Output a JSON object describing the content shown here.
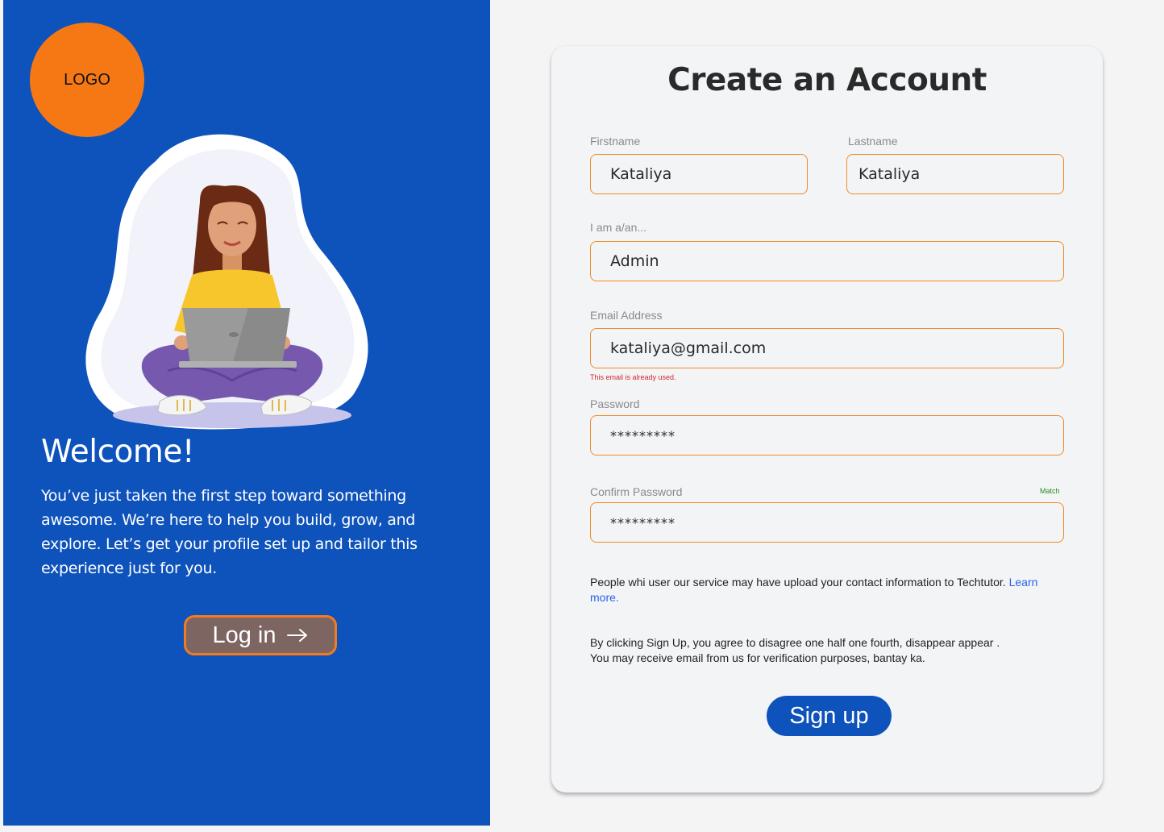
{
  "brand": {
    "logo_text": "LOGO",
    "logo_color": "#f67814",
    "primary_color": "#0e52bb",
    "accent_color": "#f37a21"
  },
  "welcome": {
    "title": "Welcome!",
    "text": "You’ve just taken the first step toward something awesome. We’re here to help you build, grow, and explore. Let’s get your profile set up and tailor this experience just for you.",
    "login_label": "Log in",
    "login_icon": "arrow-right-icon"
  },
  "form": {
    "title": "Create an Account",
    "firstname": {
      "label": "Firstname",
      "value": "Kataliya"
    },
    "lastname": {
      "label": "Lastname",
      "value": "Kataliya"
    },
    "role": {
      "label": "I am a/an...",
      "value": "Admin"
    },
    "email": {
      "label": "Email Address",
      "value": "kataliya@gmail.com",
      "error": "This email is already used."
    },
    "password": {
      "label": "Password",
      "value": "*********"
    },
    "confirm_password": {
      "label": "Confirm Password",
      "value": "*********",
      "status": "Match"
    },
    "contact_info_text": "People whi user our  service may have upload your contact information to Techtutor.",
    "learn_more": "Learn more.",
    "terms_line1": "By clicking Sign Up, you agree to disagree one half one fourth, disappear appear .",
    "terms_line2": "You may receive email from us for verification purposes, bantay ka.",
    "signup_label": "Sign up"
  },
  "colors": {
    "error": "#d7262b",
    "success": "#2a8b24",
    "link": "#2563eb",
    "input_border": "#f08a2c"
  }
}
